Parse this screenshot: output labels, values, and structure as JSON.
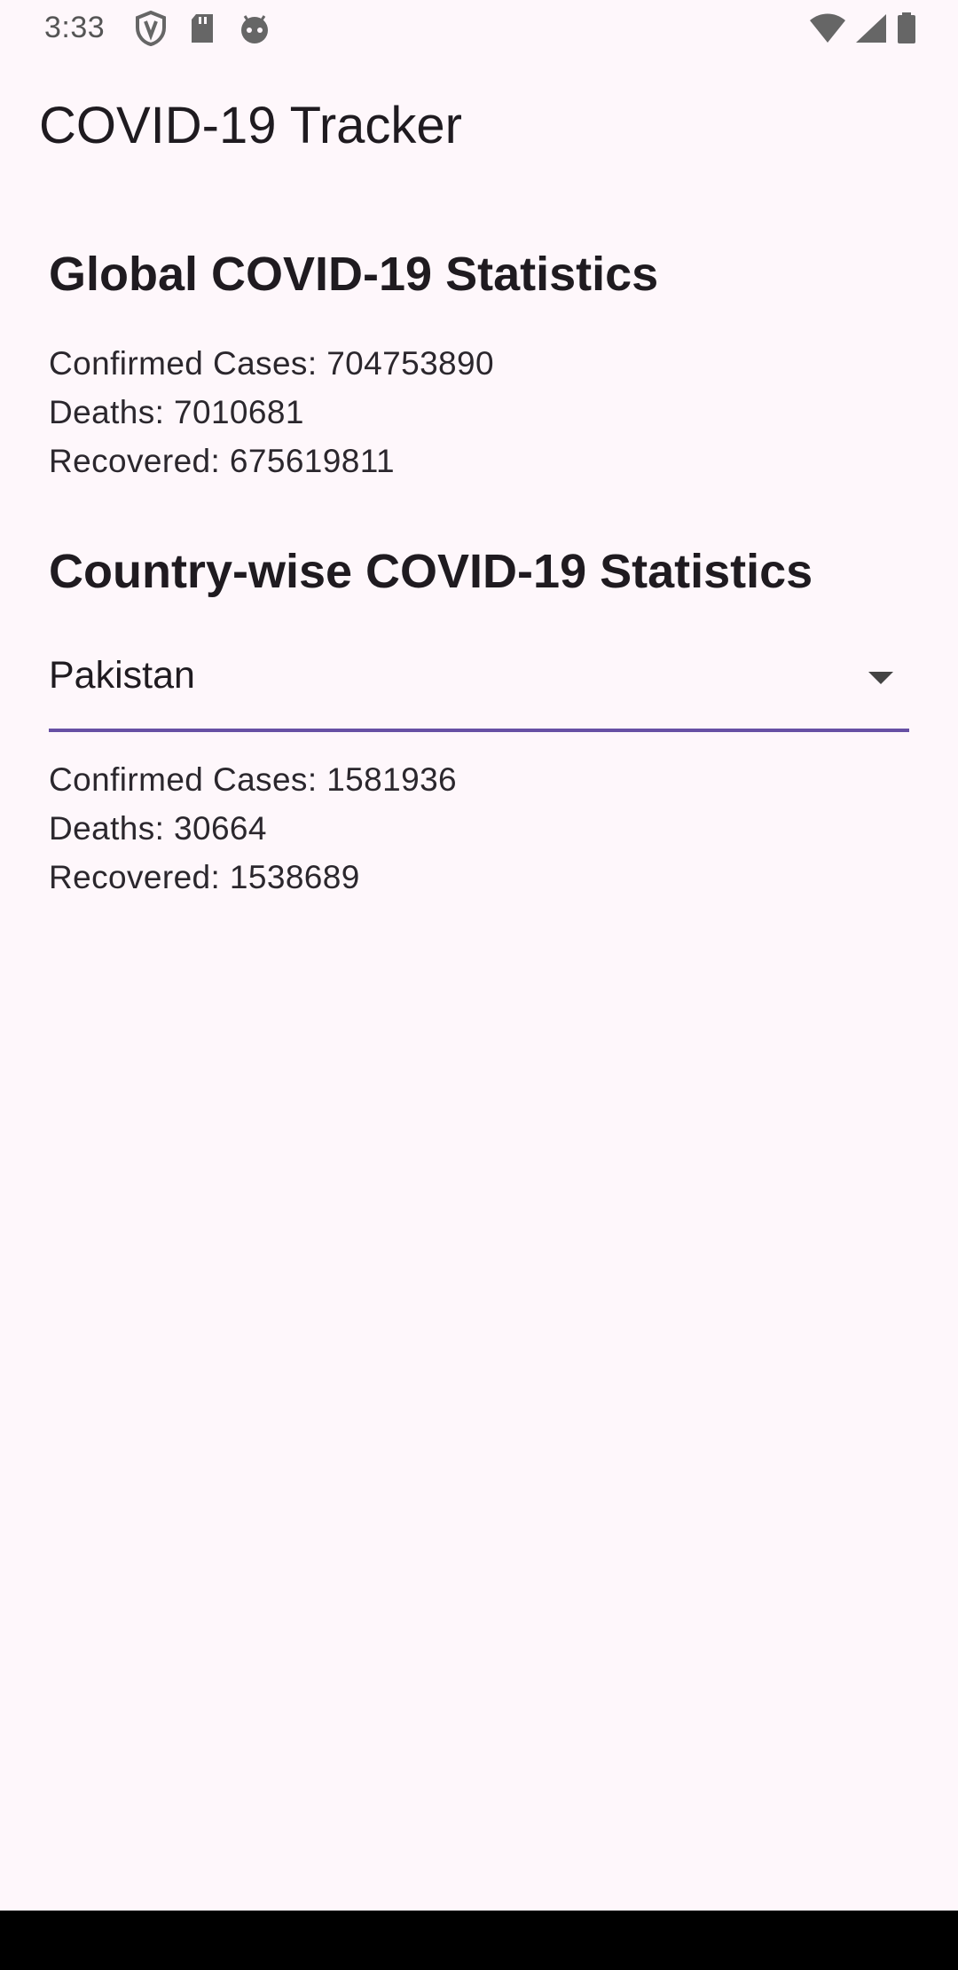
{
  "status_bar": {
    "time": "3:33",
    "left_icons": [
      "shield-icon",
      "sd-card-icon",
      "android-face-icon"
    ],
    "right_icons": [
      "wifi-icon",
      "cell-signal-icon",
      "battery-icon"
    ]
  },
  "app_bar": {
    "title": "COVID-19 Tracker"
  },
  "global": {
    "title": "Global COVID-19 Statistics",
    "confirmed": "Confirmed Cases: 704753890",
    "deaths": "Deaths: 7010681",
    "recovered": "Recovered: 675619811"
  },
  "country": {
    "title": "Country-wise COVID-19 Statistics",
    "selected": "Pakistan",
    "confirmed": "Confirmed Cases: 1581936",
    "deaths": "Deaths: 30664",
    "recovered": "Recovered: 1538689"
  },
  "colors": {
    "background": "#fef7fb",
    "accent": "#6750a4",
    "text": "#1f1b20"
  }
}
